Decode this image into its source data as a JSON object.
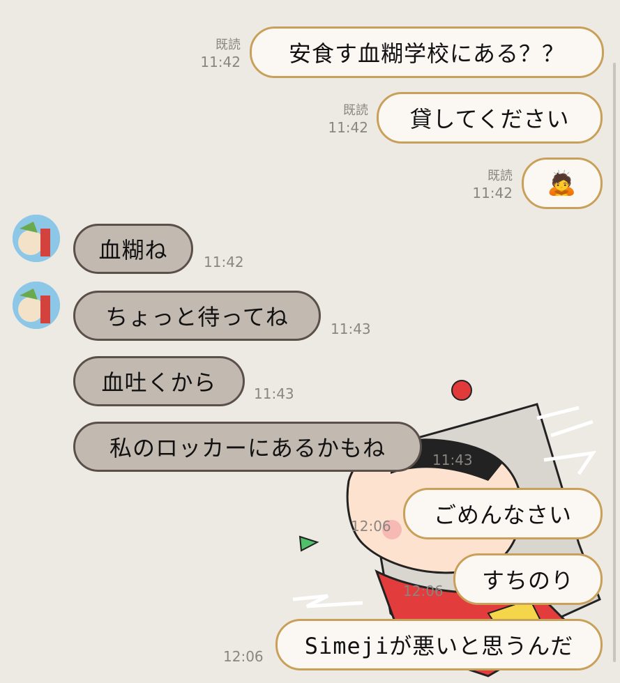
{
  "messages": [
    {
      "kind": "out",
      "text": "安食す血糊学校にある？？",
      "read": "既読",
      "time": "11:42"
    },
    {
      "kind": "out",
      "text": "貸してください",
      "read": "既読",
      "time": "11:42"
    },
    {
      "kind": "out",
      "text": "🙇",
      "read": "既読",
      "time": "11:42"
    },
    {
      "kind": "in",
      "text": "血糊ね",
      "time": "11:42"
    },
    {
      "kind": "in",
      "text": "ちょっと待ってね",
      "time": "11:43"
    },
    {
      "kind": "in",
      "text": "血吐くから",
      "time": "11:43"
    },
    {
      "kind": "in",
      "text": "私のロッカーにあるかもね",
      "time": "11:43"
    },
    {
      "kind": "out",
      "text": "ごめんなさい",
      "time": "12:06"
    },
    {
      "kind": "out",
      "text": "すちのり",
      "time": "12:06"
    },
    {
      "kind": "out",
      "text": "Simejiが悪いと思うんだ",
      "time": "12:06"
    }
  ],
  "colors": {
    "background": "#edeae4",
    "outgoing_bubble": "#fbf8f3",
    "outgoing_border": "#c9a05a",
    "incoming_bubble": "#c2b9b1",
    "incoming_border": "#5a4f49"
  }
}
